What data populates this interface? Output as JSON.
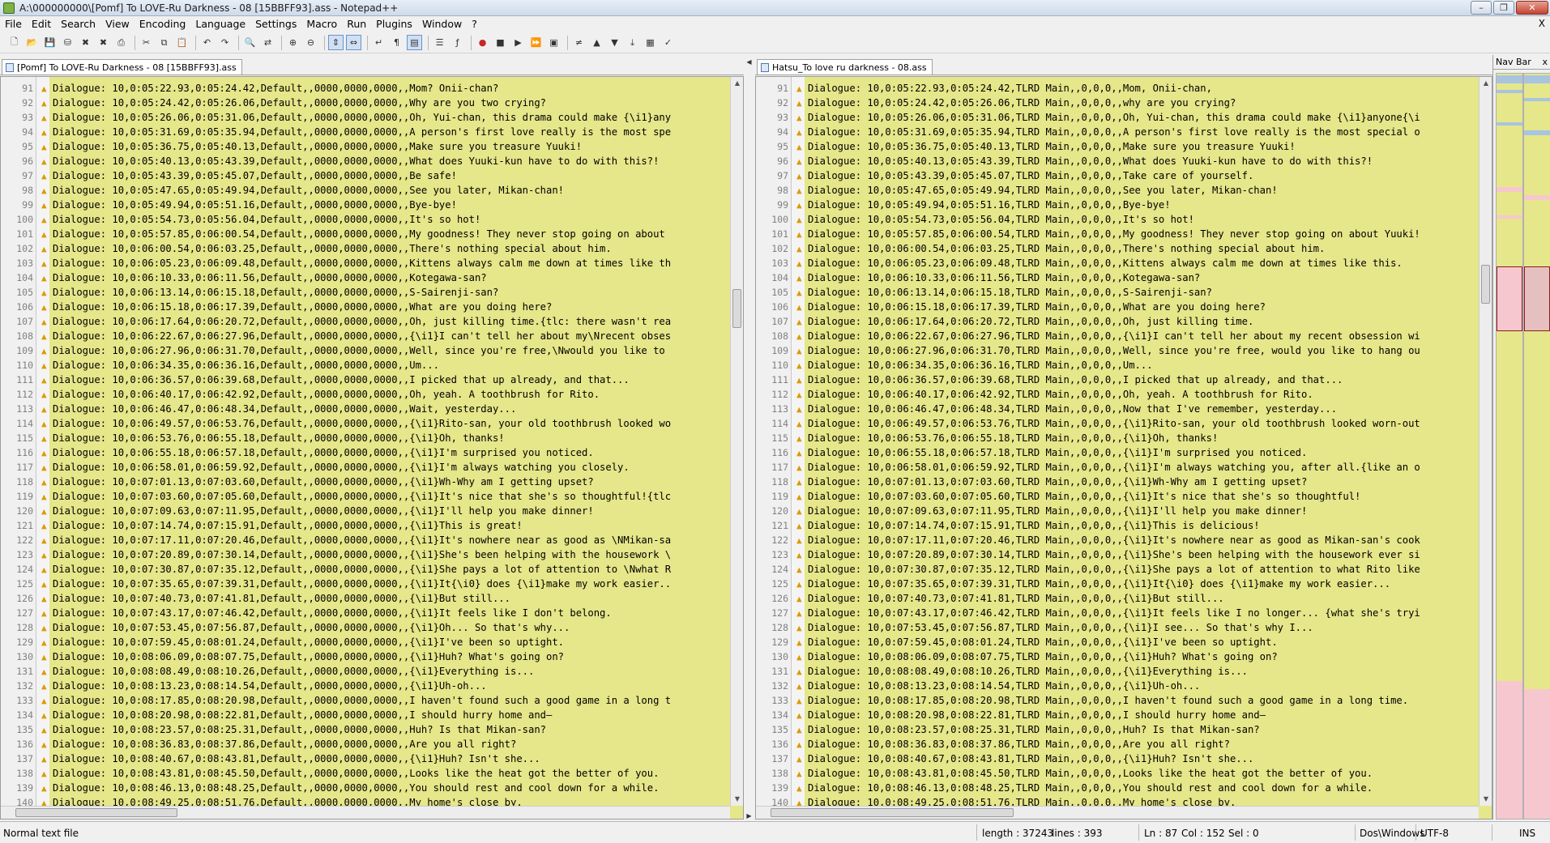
{
  "window": {
    "title": "A:\\000000000\\[Pomf] To LOVE-Ru Darkness - 08 [15BBFF93].ass - Notepad++"
  },
  "menu": [
    "File",
    "Edit",
    "Search",
    "View",
    "Encoding",
    "Language",
    "Settings",
    "Macro",
    "Run",
    "Plugins",
    "Window",
    "?"
  ],
  "menu_close": "X",
  "toolbar_icons": [
    "new-icon",
    "open-icon",
    "save-icon",
    "save-all-icon",
    "close-icon",
    "close-all-icon",
    "print-icon",
    "|",
    "cut-icon",
    "copy-icon",
    "paste-icon",
    "|",
    "undo-icon",
    "redo-icon",
    "|",
    "find-icon",
    "replace-icon",
    "|",
    "zoom-in-icon",
    "zoom-out-icon",
    "|",
    "sync-vertical-icon",
    "sync-horizontal-icon",
    "|",
    "word-wrap-icon",
    "all-chars-icon",
    "indent-guide-icon",
    "|",
    "user-lang-icon",
    "function-list-icon",
    "|",
    "record-macro-icon",
    "stop-macro-icon",
    "play-macro-icon",
    "run-macro-multiple-icon",
    "save-macro-icon",
    "|",
    "compare-icon",
    "prev-diff-icon",
    "next-diff-icon",
    "last-diff-icon",
    "nav-bar-icon",
    "spell-check-icon"
  ],
  "left_tab": "[Pomf] To LOVE-Ru Darkness - 08 [15BBFF93].ass",
  "right_tab": "Hatsu_To love ru darkness - 08.ass",
  "navbar_title": "Nav Bar",
  "navbar_close": "x",
  "left_lines": [
    {
      "n": "91",
      "t": "Dialogue: 10,0:05:22.93,0:05:24.42,Default,,0000,0000,0000,,Mom? Onii-chan?"
    },
    {
      "n": "92",
      "t": "Dialogue: 10,0:05:24.42,0:05:26.06,Default,,0000,0000,0000,,Why are you two crying?"
    },
    {
      "n": "93",
      "t": "Dialogue: 10,0:05:26.06,0:05:31.06,Default,,0000,0000,0000,,Oh, Yui-chan, this drama could make {\\i1}any"
    },
    {
      "n": "94",
      "t": "Dialogue: 10,0:05:31.69,0:05:35.94,Default,,0000,0000,0000,,A person's first love really is the most spe"
    },
    {
      "n": "95",
      "t": "Dialogue: 10,0:05:36.75,0:05:40.13,Default,,0000,0000,0000,,Make sure you treasure Yuuki!"
    },
    {
      "n": "96",
      "t": "Dialogue: 10,0:05:40.13,0:05:43.39,Default,,0000,0000,0000,,What does Yuuki-kun have to do with this?!"
    },
    {
      "n": "97",
      "t": "Dialogue: 10,0:05:43.39,0:05:45.07,Default,,0000,0000,0000,,Be safe!"
    },
    {
      "n": "98",
      "t": "Dialogue: 10,0:05:47.65,0:05:49.94,Default,,0000,0000,0000,,See you later, Mikan-chan!"
    },
    {
      "n": "99",
      "t": "Dialogue: 10,0:05:49.94,0:05:51.16,Default,,0000,0000,0000,,Bye-bye!"
    },
    {
      "n": "100",
      "t": "Dialogue: 10,0:05:54.73,0:05:56.04,Default,,0000,0000,0000,,It's so hot!"
    },
    {
      "n": "101",
      "t": "Dialogue: 10,0:05:57.85,0:06:00.54,Default,,0000,0000,0000,,My goodness! They never stop going on about "
    },
    {
      "n": "102",
      "t": "Dialogue: 10,0:06:00.54,0:06:03.25,Default,,0000,0000,0000,,There's nothing special about him."
    },
    {
      "n": "103",
      "t": "Dialogue: 10,0:06:05.23,0:06:09.48,Default,,0000,0000,0000,,Kittens always calm me down at times like th"
    },
    {
      "n": "104",
      "t": "Dialogue: 10,0:06:10.33,0:06:11.56,Default,,0000,0000,0000,,Kotegawa-san?"
    },
    {
      "n": "105",
      "t": "Dialogue: 10,0:06:13.14,0:06:15.18,Default,,0000,0000,0000,,S-Sairenji-san?"
    },
    {
      "n": "106",
      "t": "Dialogue: 10,0:06:15.18,0:06:17.39,Default,,0000,0000,0000,,What are you doing here?"
    },
    {
      "n": "107",
      "t": "Dialogue: 10,0:06:17.64,0:06:20.72,Default,,0000,0000,0000,,Oh, just killing time.{tlc: there wasn't rea"
    },
    {
      "n": "108",
      "t": "Dialogue: 10,0:06:22.67,0:06:27.96,Default,,0000,0000,0000,,{\\i1}I can't tell her about my\\Nrecent obses"
    },
    {
      "n": "109",
      "t": "Dialogue: 10,0:06:27.96,0:06:31.70,Default,,0000,0000,0000,,Well, since you're free,\\Nwould you like to "
    },
    {
      "n": "110",
      "t": "Dialogue: 10,0:06:34.35,0:06:36.16,Default,,0000,0000,0000,,Um..."
    },
    {
      "n": "111",
      "t": "Dialogue: 10,0:06:36.57,0:06:39.68,Default,,0000,0000,0000,,I picked that up already, and that..."
    },
    {
      "n": "112",
      "t": "Dialogue: 10,0:06:40.17,0:06:42.92,Default,,0000,0000,0000,,Oh, yeah. A toothbrush for Rito."
    },
    {
      "n": "113",
      "t": "Dialogue: 10,0:06:46.47,0:06:48.34,Default,,0000,0000,0000,,Wait, yesterday..."
    },
    {
      "n": "114",
      "t": "Dialogue: 10,0:06:49.57,0:06:53.76,Default,,0000,0000,0000,,{\\i1}Rito-san, your old toothbrush looked wo"
    },
    {
      "n": "115",
      "t": "Dialogue: 10,0:06:53.76,0:06:55.18,Default,,0000,0000,0000,,{\\i1}Oh, thanks!"
    },
    {
      "n": "116",
      "t": "Dialogue: 10,0:06:55.18,0:06:57.18,Default,,0000,0000,0000,,{\\i1}I'm surprised you noticed."
    },
    {
      "n": "117",
      "t": "Dialogue: 10,0:06:58.01,0:06:59.92,Default,,0000,0000,0000,,{\\i1}I'm always watching you closely."
    },
    {
      "n": "118",
      "t": "Dialogue: 10,0:07:01.13,0:07:03.60,Default,,0000,0000,0000,,{\\i1}Wh-Why am I getting upset?"
    },
    {
      "n": "119",
      "t": "Dialogue: 10,0:07:03.60,0:07:05.60,Default,,0000,0000,0000,,{\\i1}It's nice that she's so thoughtful!{tlc"
    },
    {
      "n": "120",
      "t": "Dialogue: 10,0:07:09.63,0:07:11.95,Default,,0000,0000,0000,,{\\i1}I'll help you make dinner!"
    },
    {
      "n": "121",
      "t": "Dialogue: 10,0:07:14.74,0:07:15.91,Default,,0000,0000,0000,,{\\i1}This is great!"
    },
    {
      "n": "122",
      "t": "Dialogue: 10,0:07:17.11,0:07:20.46,Default,,0000,0000,0000,,{\\i1}It's nowhere near as good as \\NMikan-sa"
    },
    {
      "n": "123",
      "t": "Dialogue: 10,0:07:20.89,0:07:30.14,Default,,0000,0000,0000,,{\\i1}She's been helping with the housework \\"
    },
    {
      "n": "124",
      "t": "Dialogue: 10,0:07:30.87,0:07:35.12,Default,,0000,0000,0000,,{\\i1}She pays a lot of attention to \\Nwhat R"
    },
    {
      "n": "125",
      "t": "Dialogue: 10,0:07:35.65,0:07:39.31,Default,,0000,0000,0000,,{\\i1}It{\\i0} does {\\i1}make my work easier.."
    },
    {
      "n": "126",
      "t": "Dialogue: 10,0:07:40.73,0:07:41.81,Default,,0000,0000,0000,,{\\i1}But still..."
    },
    {
      "n": "127",
      "t": "Dialogue: 10,0:07:43.17,0:07:46.42,Default,,0000,0000,0000,,{\\i1}It feels like I don't belong."
    },
    {
      "n": "128",
      "t": "Dialogue: 10,0:07:53.45,0:07:56.87,Default,,0000,0000,0000,,{\\i1}Oh... So that's why..."
    },
    {
      "n": "129",
      "t": "Dialogue: 10,0:07:59.45,0:08:01.24,Default,,0000,0000,0000,,{\\i1}I've been so uptight."
    },
    {
      "n": "130",
      "t": "Dialogue: 10,0:08:06.09,0:08:07.75,Default,,0000,0000,0000,,{\\i1}Huh? What's going on?"
    },
    {
      "n": "131",
      "t": "Dialogue: 10,0:08:08.49,0:08:10.26,Default,,0000,0000,0000,,{\\i1}Everything is..."
    },
    {
      "n": "132",
      "t": "Dialogue: 10,0:08:13.23,0:08:14.54,Default,,0000,0000,0000,,{\\i1}Uh-oh..."
    },
    {
      "n": "133",
      "t": "Dialogue: 10,0:08:17.85,0:08:20.98,Default,,0000,0000,0000,,I haven't found such a good game in a long t"
    },
    {
      "n": "134",
      "t": "Dialogue: 10,0:08:20.98,0:08:22.81,Default,,0000,0000,0000,,I should hurry home and—"
    },
    {
      "n": "135",
      "t": "Dialogue: 10,0:08:23.57,0:08:25.31,Default,,0000,0000,0000,,Huh? Is that Mikan-san?"
    },
    {
      "n": "136",
      "t": "Dialogue: 10,0:08:36.83,0:08:37.86,Default,,0000,0000,0000,,Are you all right?"
    },
    {
      "n": "137",
      "t": "Dialogue: 10,0:08:40.67,0:08:43.81,Default,,0000,0000,0000,,{\\i1}Huh? Isn't she..."
    },
    {
      "n": "138",
      "t": "Dialogue: 10,0:08:43.81,0:08:45.50,Default,,0000,0000,0000,,Looks like the heat got the better of you."
    },
    {
      "n": "139",
      "t": "Dialogue: 10,0:08:46.13,0:08:48.25,Default,,0000,0000,0000,,You should rest and cool down for a while."
    },
    {
      "n": "140",
      "t": "Dialogue: 10,0:08:49.25,0:08:51.76,Default,,0000,0000,0000,,My home's close by."
    }
  ],
  "right_lines": [
    {
      "n": "91",
      "t": "Dialogue: 10,0:05:22.93,0:05:24.42,TLRD Main,,0,0,0,,Mom, Onii-chan,"
    },
    {
      "n": "92",
      "t": "Dialogue: 10,0:05:24.42,0:05:26.06,TLRD Main,,0,0,0,,why are you crying?"
    },
    {
      "n": "93",
      "t": "Dialogue: 10,0:05:26.06,0:05:31.06,TLRD Main,,0,0,0,,Oh, Yui-chan, this drama could make {\\i1}anyone{\\i"
    },
    {
      "n": "94",
      "t": "Dialogue: 10,0:05:31.69,0:05:35.94,TLRD Main,,0,0,0,,A person's first love really is the most special o"
    },
    {
      "n": "95",
      "t": "Dialogue: 10,0:05:36.75,0:05:40.13,TLRD Main,,0,0,0,,Make sure you treasure Yuuki!"
    },
    {
      "n": "96",
      "t": "Dialogue: 10,0:05:40.13,0:05:43.39,TLRD Main,,0,0,0,,What does Yuuki-kun have to do with this?!"
    },
    {
      "n": "97",
      "t": "Dialogue: 10,0:05:43.39,0:05:45.07,TLRD Main,,0,0,0,,Take care of yourself."
    },
    {
      "n": "98",
      "t": "Dialogue: 10,0:05:47.65,0:05:49.94,TLRD Main,,0,0,0,,See you later, Mikan-chan!"
    },
    {
      "n": "99",
      "t": "Dialogue: 10,0:05:49.94,0:05:51.16,TLRD Main,,0,0,0,,Bye-bye!"
    },
    {
      "n": "100",
      "t": "Dialogue: 10,0:05:54.73,0:05:56.04,TLRD Main,,0,0,0,,It's so hot!"
    },
    {
      "n": "101",
      "t": "Dialogue: 10,0:05:57.85,0:06:00.54,TLRD Main,,0,0,0,,My goodness! They never stop going on about Yuuki!"
    },
    {
      "n": "102",
      "t": "Dialogue: 10,0:06:00.54,0:06:03.25,TLRD Main,,0,0,0,,There's nothing special about him."
    },
    {
      "n": "103",
      "t": "Dialogue: 10,0:06:05.23,0:06:09.48,TLRD Main,,0,0,0,,Kittens always calm me down at times like this."
    },
    {
      "n": "104",
      "t": "Dialogue: 10,0:06:10.33,0:06:11.56,TLRD Main,,0,0,0,,Kotegawa-san?"
    },
    {
      "n": "105",
      "t": "Dialogue: 10,0:06:13.14,0:06:15.18,TLRD Main,,0,0,0,,S-Sairenji-san?"
    },
    {
      "n": "106",
      "t": "Dialogue: 10,0:06:15.18,0:06:17.39,TLRD Main,,0,0,0,,What are you doing here?"
    },
    {
      "n": "107",
      "t": "Dialogue: 10,0:06:17.64,0:06:20.72,TLRD Main,,0,0,0,,Oh, just killing time."
    },
    {
      "n": "108",
      "t": "Dialogue: 10,0:06:22.67,0:06:27.96,TLRD Main,,0,0,0,,{\\i1}I can't tell her about my recent obsession wi"
    },
    {
      "n": "109",
      "t": "Dialogue: 10,0:06:27.96,0:06:31.70,TLRD Main,,0,0,0,,Well, since you're free, would you like to hang ou"
    },
    {
      "n": "110",
      "t": "Dialogue: 10,0:06:34.35,0:06:36.16,TLRD Main,,0,0,0,,Um..."
    },
    {
      "n": "111",
      "t": "Dialogue: 10,0:06:36.57,0:06:39.68,TLRD Main,,0,0,0,,I picked that up already, and that..."
    },
    {
      "n": "112",
      "t": "Dialogue: 10,0:06:40.17,0:06:42.92,TLRD Main,,0,0,0,,Oh, yeah. A toothbrush for Rito."
    },
    {
      "n": "113",
      "t": "Dialogue: 10,0:06:46.47,0:06:48.34,TLRD Main,,0,0,0,,Now that I've remember, yesterday..."
    },
    {
      "n": "114",
      "t": "Dialogue: 10,0:06:49.57,0:06:53.76,TLRD Main,,0,0,0,,{\\i1}Rito-san, your old toothbrush looked worn-out"
    },
    {
      "n": "115",
      "t": "Dialogue: 10,0:06:53.76,0:06:55.18,TLRD Main,,0,0,0,,{\\i1}Oh, thanks!"
    },
    {
      "n": "116",
      "t": "Dialogue: 10,0:06:55.18,0:06:57.18,TLRD Main,,0,0,0,,{\\i1}I'm surprised you noticed."
    },
    {
      "n": "117",
      "t": "Dialogue: 10,0:06:58.01,0:06:59.92,TLRD Main,,0,0,0,,{\\i1}I'm always watching you, after all.{like an o"
    },
    {
      "n": "118",
      "t": "Dialogue: 10,0:07:01.13,0:07:03.60,TLRD Main,,0,0,0,,{\\i1}Wh-Why am I getting upset?"
    },
    {
      "n": "119",
      "t": "Dialogue: 10,0:07:03.60,0:07:05.60,TLRD Main,,0,0,0,,{\\i1}It's nice that she's so thoughtful!"
    },
    {
      "n": "120",
      "t": "Dialogue: 10,0:07:09.63,0:07:11.95,TLRD Main,,0,0,0,,{\\i1}I'll help you make dinner!"
    },
    {
      "n": "121",
      "t": "Dialogue: 10,0:07:14.74,0:07:15.91,TLRD Main,,0,0,0,,{\\i1}This is delicious!"
    },
    {
      "n": "122",
      "t": "Dialogue: 10,0:07:17.11,0:07:20.46,TLRD Main,,0,0,0,,{\\i1}It's nowhere near as good as Mikan-san's cook"
    },
    {
      "n": "123",
      "t": "Dialogue: 10,0:07:20.89,0:07:30.14,TLRD Main,,0,0,0,,{\\i1}She's been helping with the housework ever si"
    },
    {
      "n": "124",
      "t": "Dialogue: 10,0:07:30.87,0:07:35.12,TLRD Main,,0,0,0,,{\\i1}She pays a lot of attention to what Rito like"
    },
    {
      "n": "125",
      "t": "Dialogue: 10,0:07:35.65,0:07:39.31,TLRD Main,,0,0,0,,{\\i1}It{\\i0} does {\\i1}make my work easier..."
    },
    {
      "n": "126",
      "t": "Dialogue: 10,0:07:40.73,0:07:41.81,TLRD Main,,0,0,0,,{\\i1}But still..."
    },
    {
      "n": "127",
      "t": "Dialogue: 10,0:07:43.17,0:07:46.42,TLRD Main,,0,0,0,,{\\i1}It feels like I no longer... {what she's tryi"
    },
    {
      "n": "128",
      "t": "Dialogue: 10,0:07:53.45,0:07:56.87,TLRD Main,,0,0,0,,{\\i1}I see... So that's why I..."
    },
    {
      "n": "129",
      "t": "Dialogue: 10,0:07:59.45,0:08:01.24,TLRD Main,,0,0,0,,{\\i1}I've been so uptight."
    },
    {
      "n": "130",
      "t": "Dialogue: 10,0:08:06.09,0:08:07.75,TLRD Main,,0,0,0,,{\\i1}Huh? What's going on?"
    },
    {
      "n": "131",
      "t": "Dialogue: 10,0:08:08.49,0:08:10.26,TLRD Main,,0,0,0,,{\\i1}Everything is..."
    },
    {
      "n": "132",
      "t": "Dialogue: 10,0:08:13.23,0:08:14.54,TLRD Main,,0,0,0,,{\\i1}Uh-oh..."
    },
    {
      "n": "133",
      "t": "Dialogue: 10,0:08:17.85,0:08:20.98,TLRD Main,,0,0,0,,I haven't found such a good game in a long time."
    },
    {
      "n": "134",
      "t": "Dialogue: 10,0:08:20.98,0:08:22.81,TLRD Main,,0,0,0,,I should hurry home and—"
    },
    {
      "n": "135",
      "t": "Dialogue: 10,0:08:23.57,0:08:25.31,TLRD Main,,0,0,0,,Huh? Is that Mikan-san?"
    },
    {
      "n": "136",
      "t": "Dialogue: 10,0:08:36.83,0:08:37.86,TLRD Main,,0,0,0,,Are you all right?"
    },
    {
      "n": "137",
      "t": "Dialogue: 10,0:08:40.67,0:08:43.81,TLRD Main,,0,0,0,,{\\i1}Huh? Isn't she..."
    },
    {
      "n": "138",
      "t": "Dialogue: 10,0:08:43.81,0:08:45.50,TLRD Main,,0,0,0,,Looks like the heat got the better of you."
    },
    {
      "n": "139",
      "t": "Dialogue: 10,0:08:46.13,0:08:48.25,TLRD Main,,0,0,0,,You should rest and cool down for a while."
    },
    {
      "n": "140",
      "t": "Dialogue: 10,0:08:49.25,0:08:51.76,TLRD Main,,0,0,0,,My home's close by."
    }
  ],
  "status": {
    "file_type": "Normal text file",
    "length": "length : 37243",
    "lines": "lines : 393",
    "ln": "Ln : 87",
    "col": "Col : 152",
    "sel": "Sel : 0",
    "eol": "Dos\\Windows",
    "encoding": "UTF-8",
    "mode": "INS"
  },
  "colors": {
    "diff_background": "#e6e68a",
    "changed_highlight": "#c8c87a",
    "nav_removed": "#f7c7cf",
    "nav_moved": "#a8c4e0"
  }
}
